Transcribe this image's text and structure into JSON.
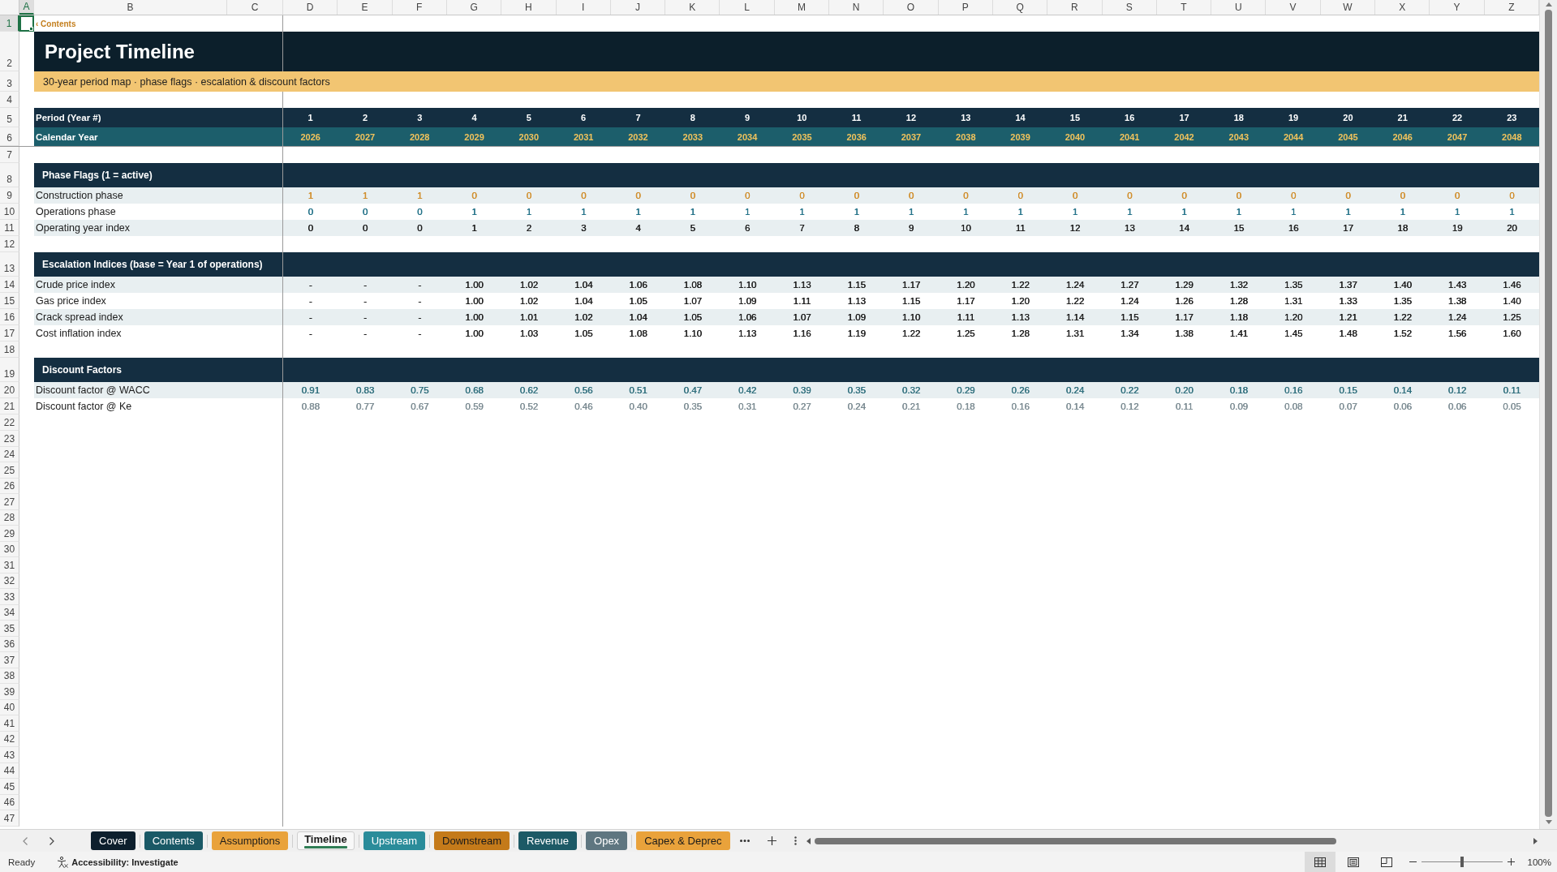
{
  "column_headers": [
    {
      "label": "A",
      "selected": true
    },
    {
      "label": "B",
      "selected": false
    },
    {
      "label": "C",
      "selected": false
    },
    {
      "label": "D",
      "selected": false
    },
    {
      "label": "E",
      "selected": false
    },
    {
      "label": "F",
      "selected": false
    },
    {
      "label": "G",
      "selected": false
    },
    {
      "label": "H",
      "selected": false
    },
    {
      "label": "I",
      "selected": false
    },
    {
      "label": "J",
      "selected": false
    },
    {
      "label": "K",
      "selected": false
    },
    {
      "label": "L",
      "selected": false
    },
    {
      "label": "M",
      "selected": false
    },
    {
      "label": "N",
      "selected": false
    },
    {
      "label": "O",
      "selected": false
    },
    {
      "label": "P",
      "selected": false
    },
    {
      "label": "Q",
      "selected": false
    },
    {
      "label": "R",
      "selected": false
    },
    {
      "label": "S",
      "selected": false
    },
    {
      "label": "T",
      "selected": false
    },
    {
      "label": "U",
      "selected": false
    },
    {
      "label": "V",
      "selected": false
    },
    {
      "label": "W",
      "selected": false
    },
    {
      "label": "X",
      "selected": false
    },
    {
      "label": "Y",
      "selected": false
    },
    {
      "label": "Z",
      "selected": false
    }
  ],
  "row_headers": [
    {
      "label": "1",
      "selected": true
    },
    {
      "label": "2",
      "selected": false
    },
    {
      "label": "3",
      "selected": false
    },
    {
      "label": "4",
      "selected": false
    },
    {
      "label": "5",
      "selected": false
    },
    {
      "label": "6",
      "selected": false
    },
    {
      "label": "7",
      "selected": false
    },
    {
      "label": "8",
      "selected": false
    },
    {
      "label": "9",
      "selected": false
    },
    {
      "label": "10",
      "selected": false
    },
    {
      "label": "11",
      "selected": false
    },
    {
      "label": "12",
      "selected": false
    },
    {
      "label": "13",
      "selected": false
    },
    {
      "label": "14",
      "selected": false
    },
    {
      "label": "15",
      "selected": false
    },
    {
      "label": "16",
      "selected": false
    },
    {
      "label": "17",
      "selected": false
    },
    {
      "label": "18",
      "selected": false
    },
    {
      "label": "19",
      "selected": false
    },
    {
      "label": "20",
      "selected": false
    },
    {
      "label": "21",
      "selected": false
    },
    {
      "label": "22",
      "selected": false
    },
    {
      "label": "23",
      "selected": false
    },
    {
      "label": "24",
      "selected": false
    },
    {
      "label": "25",
      "selected": false
    },
    {
      "label": "26",
      "selected": false
    },
    {
      "label": "27",
      "selected": false
    },
    {
      "label": "28",
      "selected": false
    },
    {
      "label": "29",
      "selected": false
    },
    {
      "label": "30",
      "selected": false
    },
    {
      "label": "31",
      "selected": false
    },
    {
      "label": "32",
      "selected": false
    },
    {
      "label": "33",
      "selected": false
    },
    {
      "label": "34",
      "selected": false
    },
    {
      "label": "35",
      "selected": false
    },
    {
      "label": "36",
      "selected": false
    },
    {
      "label": "37",
      "selected": false
    },
    {
      "label": "38",
      "selected": false
    },
    {
      "label": "39",
      "selected": false
    },
    {
      "label": "40",
      "selected": false
    },
    {
      "label": "41",
      "selected": false
    },
    {
      "label": "42",
      "selected": false
    },
    {
      "label": "43",
      "selected": false
    },
    {
      "label": "44",
      "selected": false
    },
    {
      "label": "45",
      "selected": false
    },
    {
      "label": "46",
      "selected": false
    },
    {
      "label": "47",
      "selected": false
    }
  ],
  "contents_link": "‹ Contents",
  "title": "Project Timeline",
  "subtitle": "30-year period map · phase flags · escalation & discount factors",
  "period_row": {
    "label": "Period (Year #)",
    "values": [
      "1",
      "2",
      "3",
      "4",
      "5",
      "6",
      "7",
      "8",
      "9",
      "10",
      "11",
      "12",
      "13",
      "14",
      "15",
      "16",
      "17",
      "18",
      "19",
      "20",
      "21",
      "22",
      "23"
    ]
  },
  "year_row": {
    "label": "Calendar Year",
    "values": [
      "2026",
      "2027",
      "2028",
      "2029",
      "2030",
      "2031",
      "2032",
      "2033",
      "2034",
      "2035",
      "2036",
      "2037",
      "2038",
      "2039",
      "2040",
      "2041",
      "2042",
      "2043",
      "2044",
      "2045",
      "2046",
      "2047",
      "2048"
    ]
  },
  "sections": [
    {
      "title": "Phase Flags (1 = active)",
      "rows": [
        {
          "label": "Construction phase",
          "color": "#d08c28",
          "values": [
            "1",
            "1",
            "1",
            "0",
            "0",
            "0",
            "0",
            "0",
            "0",
            "0",
            "0",
            "0",
            "0",
            "0",
            "0",
            "0",
            "0",
            "0",
            "0",
            "0",
            "0",
            "0",
            "0"
          ]
        },
        {
          "label": "Operations phase",
          "color": "#1f6f86",
          "values": [
            "0",
            "0",
            "0",
            "1",
            "1",
            "1",
            "1",
            "1",
            "1",
            "1",
            "1",
            "1",
            "1",
            "1",
            "1",
            "1",
            "1",
            "1",
            "1",
            "1",
            "1",
            "1",
            "1"
          ]
        },
        {
          "label": "Operating year index",
          "color": "#1a1a1a",
          "values": [
            "0",
            "0",
            "0",
            "1",
            "2",
            "3",
            "4",
            "5",
            "6",
            "7",
            "8",
            "9",
            "10",
            "11",
            "12",
            "13",
            "14",
            "15",
            "16",
            "17",
            "18",
            "19",
            "20"
          ]
        }
      ]
    },
    {
      "title": "Escalation Indices (base = Year 1 of operations)",
      "rows": [
        {
          "label": "Crude price index",
          "values": [
            "-",
            "-",
            "-",
            "1.00",
            "1.02",
            "1.04",
            "1.06",
            "1.08",
            "1.10",
            "1.13",
            "1.15",
            "1.17",
            "1.20",
            "1.22",
            "1.24",
            "1.27",
            "1.29",
            "1.32",
            "1.35",
            "1.37",
            "1.40",
            "1.43",
            "1.46"
          ]
        },
        {
          "label": "Gas price index",
          "values": [
            "-",
            "-",
            "-",
            "1.00",
            "1.02",
            "1.04",
            "1.05",
            "1.07",
            "1.09",
            "1.11",
            "1.13",
            "1.15",
            "1.17",
            "1.20",
            "1.22",
            "1.24",
            "1.26",
            "1.28",
            "1.31",
            "1.33",
            "1.35",
            "1.38",
            "1.40"
          ]
        },
        {
          "label": "Crack spread index",
          "values": [
            "-",
            "-",
            "-",
            "1.00",
            "1.01",
            "1.02",
            "1.04",
            "1.05",
            "1.06",
            "1.07",
            "1.09",
            "1.10",
            "1.11",
            "1.13",
            "1.14",
            "1.15",
            "1.17",
            "1.18",
            "1.20",
            "1.21",
            "1.22",
            "1.24",
            "1.25"
          ]
        },
        {
          "label": "Cost inflation index",
          "values": [
            "-",
            "-",
            "-",
            "1.00",
            "1.03",
            "1.05",
            "1.08",
            "1.10",
            "1.13",
            "1.16",
            "1.19",
            "1.22",
            "1.25",
            "1.28",
            "1.31",
            "1.34",
            "1.38",
            "1.41",
            "1.45",
            "1.48",
            "1.52",
            "1.56",
            "1.60"
          ]
        }
      ]
    },
    {
      "title": "Discount Factors",
      "rows": [
        {
          "label": "Discount factor @ WACC",
          "color": "#2e6e7c",
          "values": [
            "0.91",
            "0.83",
            "0.75",
            "0.68",
            "0.62",
            "0.56",
            "0.51",
            "0.47",
            "0.42",
            "0.39",
            "0.35",
            "0.32",
            "0.29",
            "0.26",
            "0.24",
            "0.22",
            "0.20",
            "0.18",
            "0.16",
            "0.15",
            "0.14",
            "0.12",
            "0.11"
          ]
        },
        {
          "label": "Discount factor @ Ke",
          "color": "#7b8b92",
          "values": [
            "0.88",
            "0.77",
            "0.67",
            "0.59",
            "0.52",
            "0.46",
            "0.40",
            "0.35",
            "0.31",
            "0.27",
            "0.24",
            "0.21",
            "0.18",
            "0.16",
            "0.14",
            "0.12",
            "0.11",
            "0.09",
            "0.08",
            "0.07",
            "0.06",
            "0.06",
            "0.05"
          ]
        }
      ]
    }
  ],
  "sheet_tabs": [
    {
      "label": "Cover",
      "color": "#0d1f2d",
      "selected": false
    },
    {
      "label": "Contents",
      "color": "#1a5966",
      "selected": false
    },
    {
      "label": "Assumptions",
      "color": "#e9a23b",
      "selected": false
    },
    {
      "label": "Timeline",
      "color": "#2f7d55",
      "selected": true
    },
    {
      "label": "Upstream",
      "color": "#2a8c9a",
      "selected": false
    },
    {
      "label": "Downstream",
      "color": "#c47a1a",
      "selected": false
    },
    {
      "label": "Revenue",
      "color": "#1d5a66",
      "selected": false
    },
    {
      "label": "Opex",
      "color": "#5f7680",
      "selected": false
    },
    {
      "label": "Capex & Deprec",
      "color": "#e9a23b",
      "selected": false
    }
  ],
  "status_bar": {
    "status": "Ready",
    "accessibility": "Accessibility: Investigate",
    "views": [
      {
        "kind": "normal",
        "selected": true
      },
      {
        "kind": "page-layout",
        "selected": false
      },
      {
        "kind": "page-break",
        "selected": false
      }
    ],
    "zoom": {
      "level": 0.5,
      "reading": "100%"
    }
  }
}
